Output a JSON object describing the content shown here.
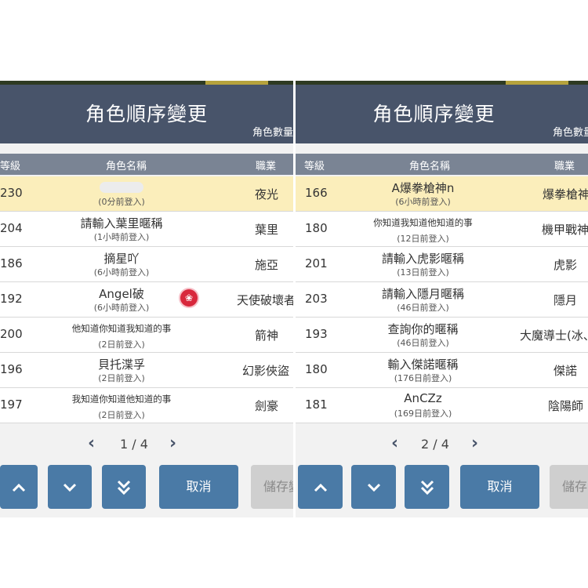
{
  "left": {
    "title": "角色順序變更",
    "count_label": "角色數量",
    "columns": {
      "level": "等級",
      "name": "角色名稱",
      "job": "職業"
    },
    "rows": [
      {
        "level": "230",
        "name": "",
        "login": "(0分前登入)",
        "job": "夜光"
      },
      {
        "level": "204",
        "name": "請輸入葉里暱稱",
        "login": "(1小時前登入)",
        "job": "葉里"
      },
      {
        "level": "186",
        "name": "摘星吖",
        "login": "(6小時前登入)",
        "job": "施亞"
      },
      {
        "level": "192",
        "name": "Angel破",
        "login": "(6小時前登入)",
        "job": "天使破壞者"
      },
      {
        "level": "200",
        "name": "他知道你知道我知道的事",
        "login": "(2日前登入)",
        "job": "箭神"
      },
      {
        "level": "196",
        "name": "貝托渫孚",
        "login": "(2日前登入)",
        "job": "幻影俠盜"
      },
      {
        "level": "197",
        "name": "我知道你知道他知道的事",
        "login": "(2日前登入)",
        "job": "劍豪"
      }
    ],
    "page": "1 / 4",
    "cancel": "取消",
    "save": "儲存變"
  },
  "right": {
    "title": "角色順序變更",
    "count_label": "角色數量",
    "columns": {
      "level": "等級",
      "name": "角色名稱",
      "job": "職業"
    },
    "rows": [
      {
        "level": "166",
        "name": "A爆拳槍神n",
        "login": "(6小時前登入)",
        "job": "爆拳槍神"
      },
      {
        "level": "180",
        "name": "你知道我知道他知道的事",
        "login": "(12日前登入)",
        "job": "機甲戰神"
      },
      {
        "level": "201",
        "name": "請輸入虎影暱稱",
        "login": "(13日前登入)",
        "job": "虎影"
      },
      {
        "level": "203",
        "name": "請輸入隱月暱稱",
        "login": "(46日前登入)",
        "job": "隱月"
      },
      {
        "level": "193",
        "name": "查詢你的暱稱",
        "login": "(46日前登入)",
        "job": "大魔導士(冰、"
      },
      {
        "level": "180",
        "name": "輸入傑諾暱稱",
        "login": "(176日前登入)",
        "job": "傑諾"
      },
      {
        "level": "181",
        "name": "AnCZz",
        "login": "(169日前登入)",
        "job": "陰陽師"
      }
    ],
    "page": "2 / 4",
    "cancel": "取消",
    "save": "儲存"
  },
  "colors": {
    "header": "#48546a",
    "column_header": "#7a8494",
    "selected_row": "#fbeebb",
    "button": "#4a7aa6"
  },
  "icons": {
    "prev": "chevron-left-icon",
    "next": "chevron-right-icon",
    "up": "chevron-up-icon",
    "down": "chevron-down-icon",
    "bottom": "double-chevron-down-icon",
    "badge": "event-badge-icon"
  }
}
